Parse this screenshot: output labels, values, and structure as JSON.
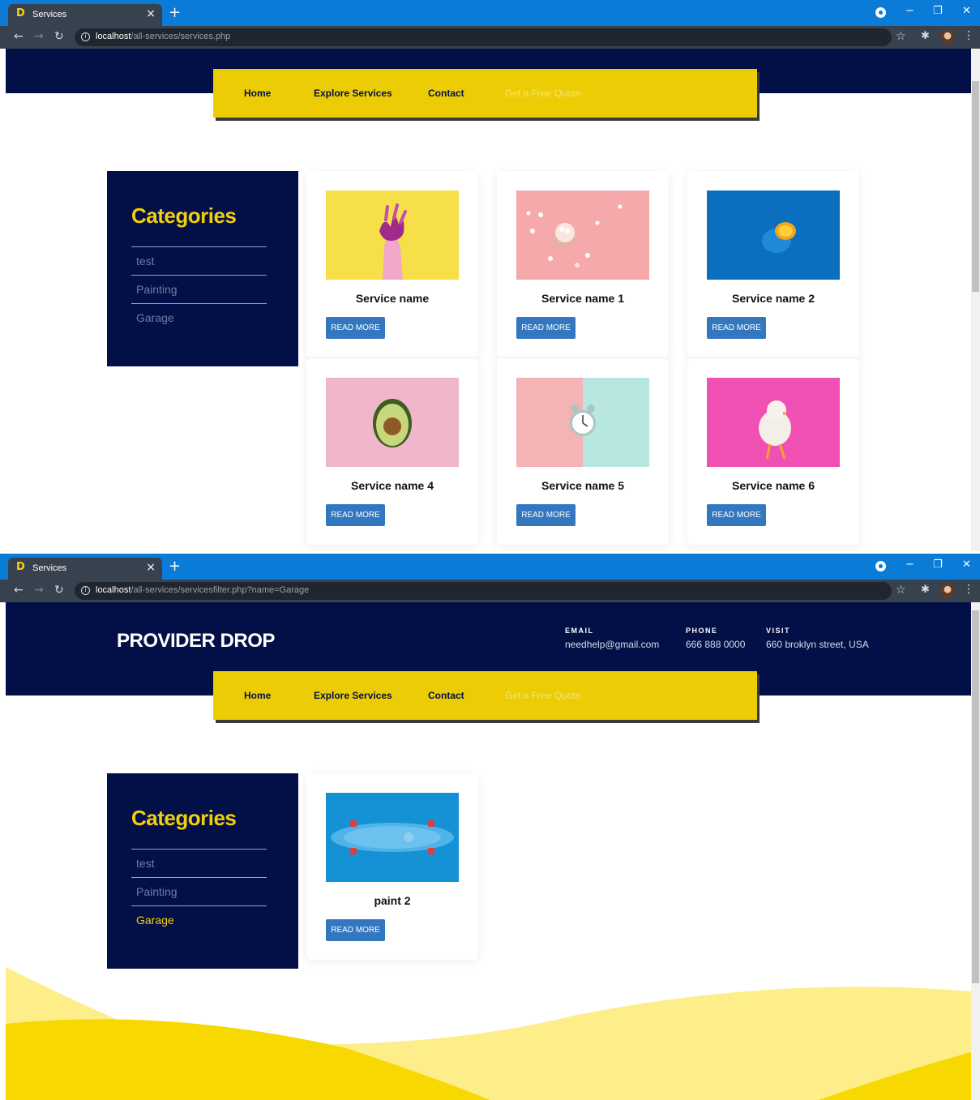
{
  "screens": [
    {
      "tab_title": "Services",
      "url_host": "localhost",
      "url_path": "/all-services/services.php",
      "nav": {
        "home": "Home",
        "explore": "Explore Services",
        "contact": "Contact",
        "quote": "Get a Free Quote"
      },
      "categories_title": "Categories",
      "categories": [
        "test",
        "Painting",
        "Garage"
      ],
      "active_category": "",
      "cards": [
        {
          "title": "Service name",
          "button": "READ MORE",
          "image": "hand-with-purple-flowers-on-yellow"
        },
        {
          "title": "Service name 1",
          "button": "READ MORE",
          "image": "marshmallows-cup-on-pink"
        },
        {
          "title": "Service name 2",
          "button": "READ MORE",
          "image": "blue-orange-on-blue"
        },
        {
          "title": "Service name 4",
          "button": "READ MORE",
          "image": "avocado-on-pink"
        },
        {
          "title": "Service name 5",
          "button": "READ MORE",
          "image": "alarm-clock-on-pink-teal"
        },
        {
          "title": "Service name 6",
          "button": "READ MORE",
          "image": "chick-on-magenta"
        }
      ]
    },
    {
      "tab_title": "Services",
      "url_host": "localhost",
      "url_path": "/all-services/servicesfilter.php?name=Garage",
      "brand": "PROVIDER DROP",
      "contacts": [
        {
          "label": "EMAIL",
          "value": "needhelp@gmail.com"
        },
        {
          "label": "PHONE",
          "value": "666 888 0000"
        },
        {
          "label": "VISIT",
          "value": "660 broklyn street, USA"
        }
      ],
      "nav": {
        "home": "Home",
        "explore": "Explore Services",
        "contact": "Contact",
        "quote": "Get a Free Quote"
      },
      "categories_title": "Categories",
      "categories": [
        "test",
        "Painting",
        "Garage"
      ],
      "active_category": "Garage",
      "cards": [
        {
          "title": "paint 2",
          "button": "READ MORE",
          "image": "skateboard-on-blue"
        }
      ]
    }
  ],
  "colors": {
    "navy": "#021047",
    "yellow": "#eccd05",
    "button_blue": "#3377c0",
    "chrome_blue": "#0a7bd6"
  }
}
